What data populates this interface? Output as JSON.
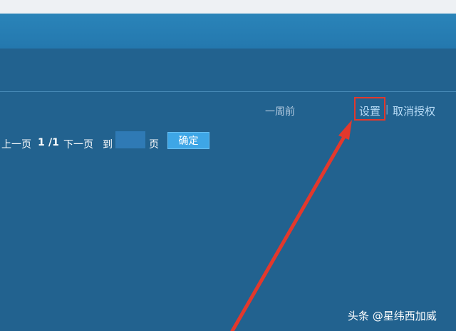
{
  "row": {
    "time": "一周前",
    "settings_label": "设置",
    "separator": "|",
    "revoke_label": "取消授权"
  },
  "pagination": {
    "prev_label": "上一页",
    "current_page": "1",
    "total_pages": "/1",
    "next_label": "下一页",
    "goto_label": "到",
    "page_input_value": "",
    "page_unit": "页",
    "confirm_label": "确定"
  },
  "annotation": {
    "highlight_color": "#e3382c",
    "arrow_color": "#e3382c"
  },
  "watermark": {
    "text": "头条 @星纬西加威"
  }
}
